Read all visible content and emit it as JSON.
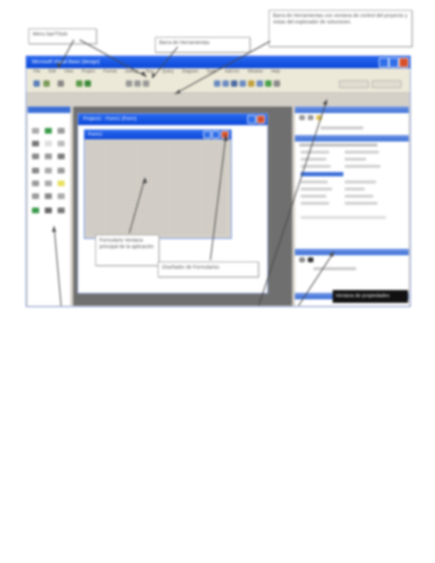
{
  "callouts": {
    "menu_bar": "Menu bar/Título",
    "toolbar": "Barra de Herramientas",
    "project_explorer": "Barra de Herramientas con ventana de control del proyecto y vistas del explorador de soluciones",
    "form": "Formulario Ventana principal de la aplicación",
    "designer": "Diseñador de Formularios",
    "status": "Ventana de propiedades"
  },
  "app": {
    "title": "Microsoft Visual Basic [design]",
    "menu": [
      "File",
      "Edit",
      "View",
      "Project",
      "Format",
      "Debug",
      "Run",
      "Query",
      "Diagram",
      "Tools",
      "Add-Ins",
      "Window",
      "Help"
    ]
  },
  "designer": {
    "title": "Project1 - Form1 (Form)"
  },
  "form": {
    "title": "Form1"
  },
  "colors": {
    "titlebar": "#0a46d8",
    "panel": "#d4d0c8",
    "workspace": "#6f6f6f",
    "close": "#d8512d"
  }
}
